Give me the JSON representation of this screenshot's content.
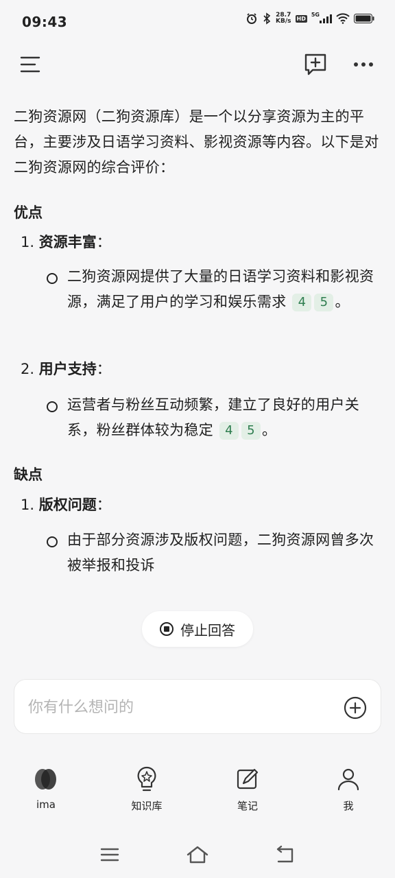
{
  "status_bar": {
    "time": "09:43",
    "net_speed_value": "28.7",
    "net_speed_unit": "KB/s",
    "hd_badge": "HD",
    "network_type": "5G"
  },
  "top_bar": {
    "menu_icon": "hamburger-menu-icon",
    "new_chat_icon": "new-chat-icon",
    "more_icon": "more-dots-icon"
  },
  "answer": {
    "intro": "二狗资源网（二狗资源库）是一个以分享资源为主的平台，主要涉及日语学习资料、影视资源等内容。以下是对二狗资源网的综合评价：",
    "pros": {
      "title": "优点",
      "items": [
        {
          "num": "1.",
          "title": "资源丰富",
          "colon": "：",
          "bullet": "二狗资源网提供了大量的日语学习资料和影视资源，满足了用户的学习和娱乐需求",
          "cites": [
            "4",
            "5"
          ],
          "end": "。"
        },
        {
          "num": "2.",
          "title": "用户支持",
          "colon": "：",
          "bullet": "运营者与粉丝互动频繁，建立了良好的用户关系，粉丝群体较为稳定",
          "cites": [
            "4",
            "5"
          ],
          "end": "。"
        }
      ]
    },
    "cons": {
      "title": "缺点",
      "items": [
        {
          "num": "1.",
          "title": "版权问题",
          "colon": "：",
          "bullet": "由于部分资源涉及版权问题，二狗资源网曾多次被举报和投诉"
        }
      ]
    }
  },
  "stop_button": {
    "label": "停止回答",
    "icon": "stop-circle-icon"
  },
  "input": {
    "placeholder": "你有什么想问的",
    "value": "",
    "attach_icon": "plus-circle-icon"
  },
  "bottom_nav": [
    {
      "label": "ima",
      "icon": "ima-logo-icon"
    },
    {
      "label": "知识库",
      "icon": "knowledge-bulb-icon"
    },
    {
      "label": "笔记",
      "icon": "note-edit-icon"
    },
    {
      "label": "我",
      "icon": "user-profile-icon"
    }
  ],
  "system_nav": {
    "recent": "recent-apps-icon",
    "home": "home-icon",
    "back": "back-icon"
  }
}
